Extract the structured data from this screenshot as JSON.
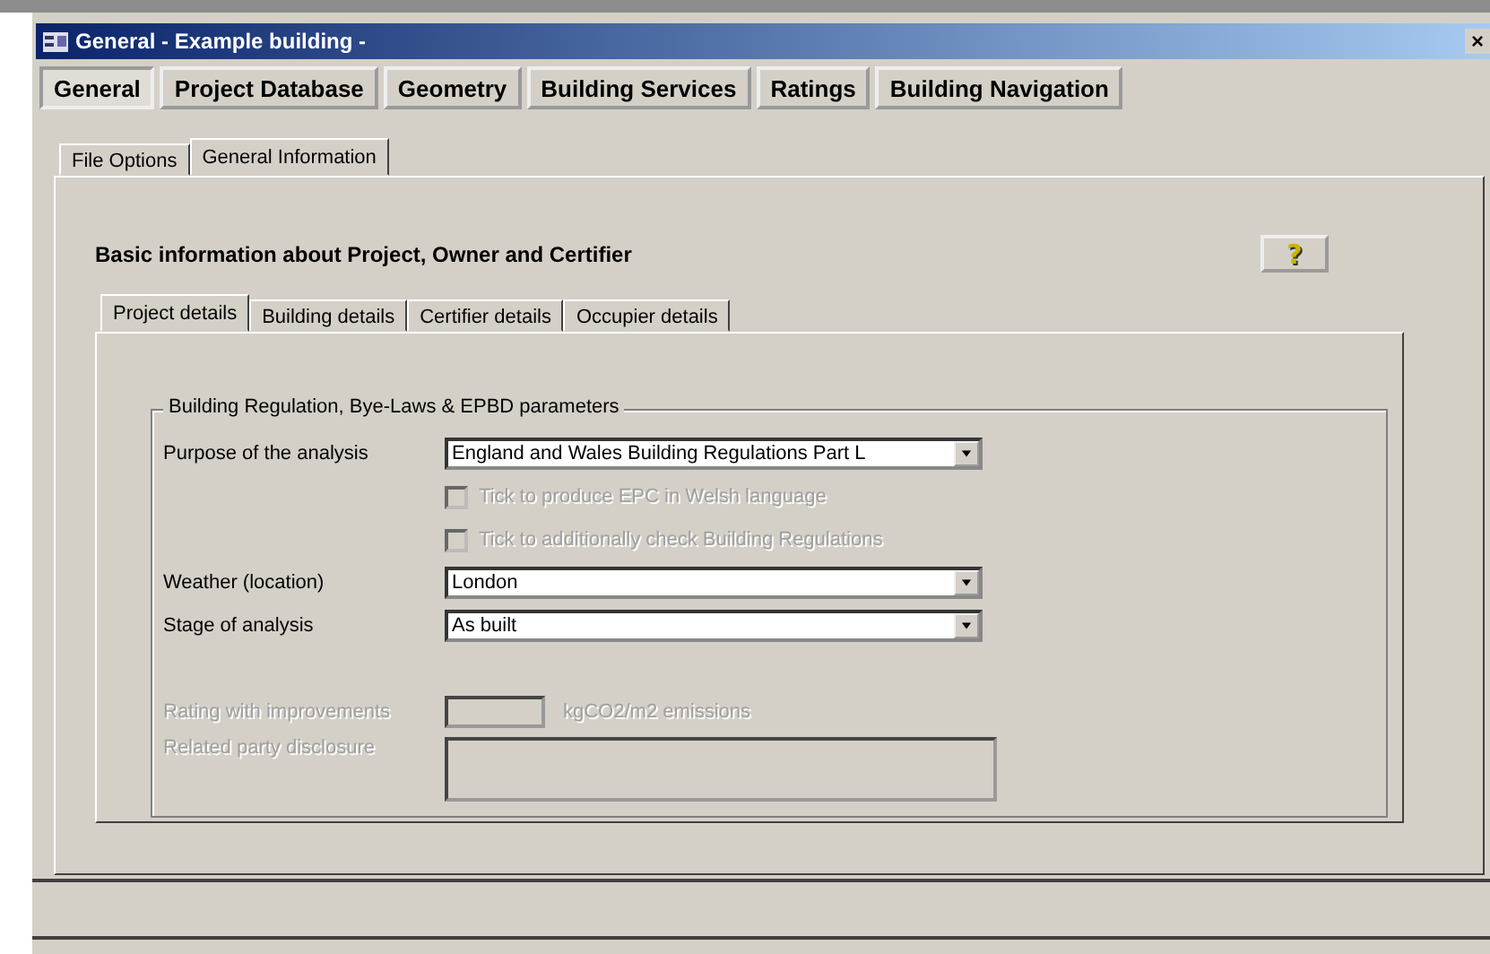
{
  "window": {
    "title": "General - Example building -",
    "close": "×"
  },
  "main_tabs": [
    {
      "label": "General",
      "selected": true
    },
    {
      "label": "Project Database",
      "selected": false
    },
    {
      "label": "Geometry",
      "selected": false
    },
    {
      "label": "Building Services",
      "selected": false
    },
    {
      "label": "Ratings",
      "selected": false
    },
    {
      "label": "Building Navigation",
      "selected": false
    }
  ],
  "sub_tabs": [
    {
      "label": "File Options",
      "selected": false
    },
    {
      "label": "General Information",
      "selected": true
    }
  ],
  "heading": "Basic information about Project, Owner and Certifier",
  "help_button": {
    "label": "?"
  },
  "detail_tabs": [
    {
      "label": "Project details",
      "selected": true
    },
    {
      "label": "Building details",
      "selected": false
    },
    {
      "label": "Certifier details",
      "selected": false
    },
    {
      "label": "Occupier details",
      "selected": false
    }
  ],
  "group": {
    "title": "Building Regulation, Bye-Laws & EPBD parameters",
    "rows": [
      {
        "kind": "select",
        "label": "Purpose of the analysis",
        "value": "England and Wales Building Regulations Part L"
      },
      {
        "kind": "checkbox",
        "label": "Tick to produce EPC in Welsh language",
        "checked": false,
        "disabled": true
      },
      {
        "kind": "checkbox",
        "label": "Tick to additionally check Building Regulations",
        "checked": false,
        "disabled": true
      },
      {
        "kind": "select",
        "label": "Weather (location)",
        "value": "London"
      },
      {
        "kind": "select",
        "label": "Stage of analysis",
        "value": "As built"
      }
    ],
    "extra_rows": [
      {
        "kind": "number",
        "label": "Rating with improvements",
        "unit": "kgCO2/m2 emissions",
        "disabled": true
      },
      {
        "kind": "memo",
        "label": "Related party disclosure",
        "disabled": true
      }
    ]
  }
}
